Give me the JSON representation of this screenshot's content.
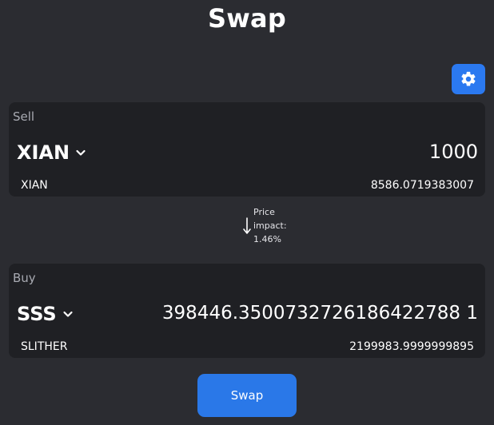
{
  "page": {
    "title": "Swap"
  },
  "settings": {
    "icon": "gear-icon"
  },
  "sell": {
    "label": "Sell",
    "token_symbol": "XIAN",
    "token_name": "XIAN",
    "amount": "1000",
    "balance": "8586.0719383007"
  },
  "buy": {
    "label": "Buy",
    "token_symbol": "SSS",
    "token_name": "SLITHER",
    "amount": "398446.3500732726186422788 1",
    "balance": "2199983.9999999895"
  },
  "price_impact": {
    "label": "Price\nimpact:",
    "line1": "Price",
    "line2": "impact:",
    "value": "1.46%"
  },
  "actions": {
    "swap_label": "Swap"
  },
  "colors": {
    "background": "#2b2c31",
    "panel": "#1f2024",
    "accent": "#2b79f0"
  },
  "icons": {
    "dropdown": "chevron-down-icon",
    "direction": "arrow-down-icon"
  }
}
